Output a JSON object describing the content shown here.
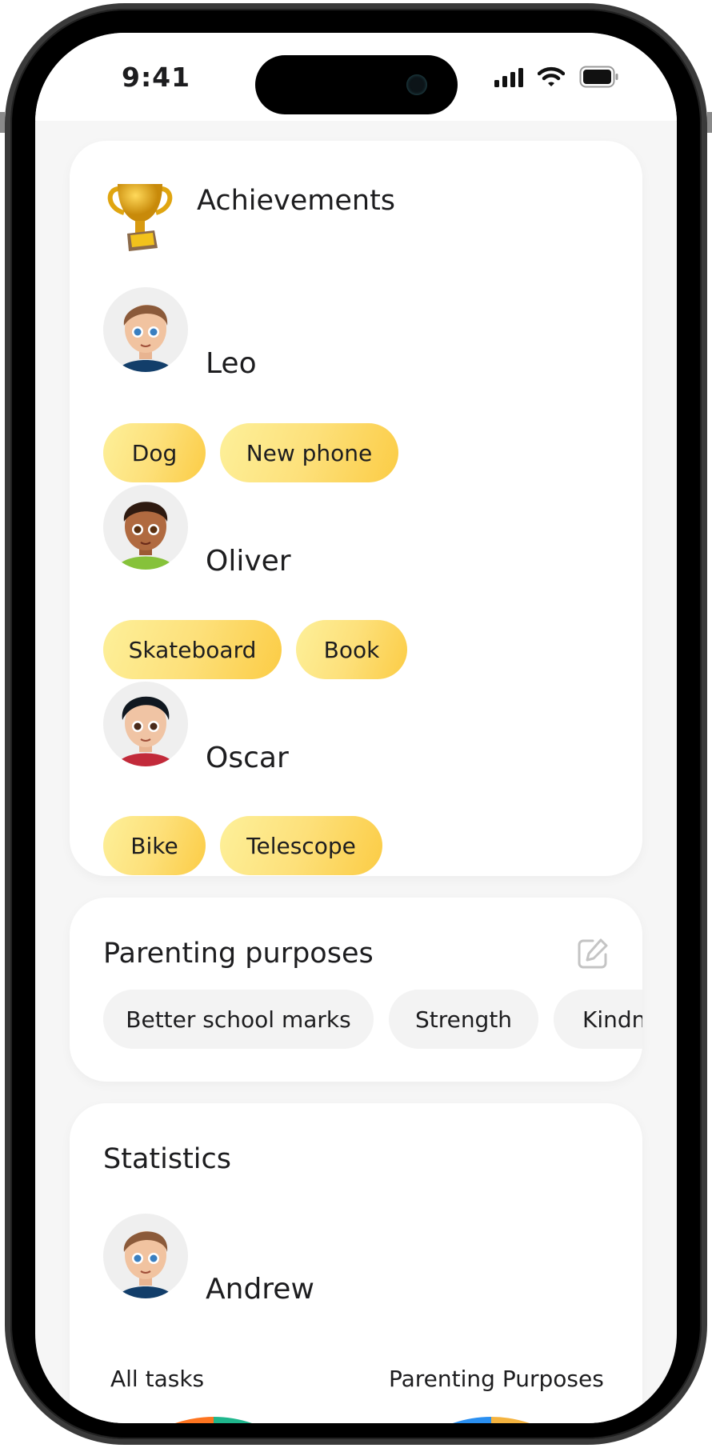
{
  "status_bar": {
    "time": "9:41",
    "signal": "cellular-signal-icon",
    "wifi": "wifi-icon",
    "battery": "battery-icon"
  },
  "achievements": {
    "title": "Achievements",
    "icon": "trophy-icon",
    "children": [
      {
        "name": "Leo",
        "rewards": [
          "Dog",
          "New phone"
        ]
      },
      {
        "name": "Oliver",
        "rewards": [
          "Skateboard",
          "Book"
        ]
      },
      {
        "name": "Oscar",
        "rewards": [
          "Bike",
          "Telescope"
        ]
      }
    ]
  },
  "purposes": {
    "title": "Parenting purposes",
    "edit_icon": "edit-icon",
    "items": [
      "Better school marks",
      "Strength",
      "Kindn"
    ]
  },
  "statistics": {
    "title": "Statistics",
    "child": "Andrew",
    "charts": [
      {
        "label": "All tasks",
        "colors": [
          "#fd7420",
          "#1fb68c"
        ]
      },
      {
        "label": "Parenting Purposes",
        "colors": [
          "#2a8ff0",
          "#f4b33f"
        ]
      }
    ]
  }
}
